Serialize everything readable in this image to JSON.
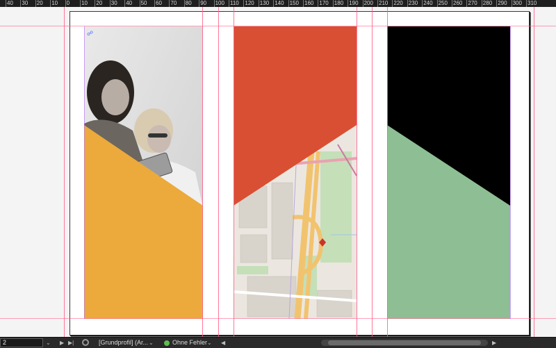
{
  "ruler": {
    "labels": [
      "40",
      "30",
      "20",
      "10",
      "0",
      "10",
      "20",
      "30",
      "40",
      "50",
      "60",
      "70",
      "80",
      "90",
      "100",
      "110",
      "120",
      "130",
      "140",
      "150",
      "160",
      "170",
      "180",
      "190",
      "200",
      "210",
      "220",
      "230",
      "240",
      "250",
      "260",
      "270",
      "280",
      "290",
      "300",
      "310"
    ]
  },
  "document": {
    "panels": [
      {
        "name": "photo-panel",
        "top_color": "#8f8f8f",
        "bottom_color": "#ecaa3c"
      },
      {
        "name": "map-panel",
        "top_color": "#d94f33",
        "bottom_color": "#e6e1d6"
      },
      {
        "name": "color-panel",
        "top_color": "#000000",
        "bottom_color": "#8ebf94"
      }
    ],
    "link_icon": "link-icon"
  },
  "statusbar": {
    "page_number": "2",
    "profile_text": "[Grundprofil] (Ar...",
    "preflight_text": "Ohne Fehler",
    "ok_color": "#5fbf4f"
  }
}
